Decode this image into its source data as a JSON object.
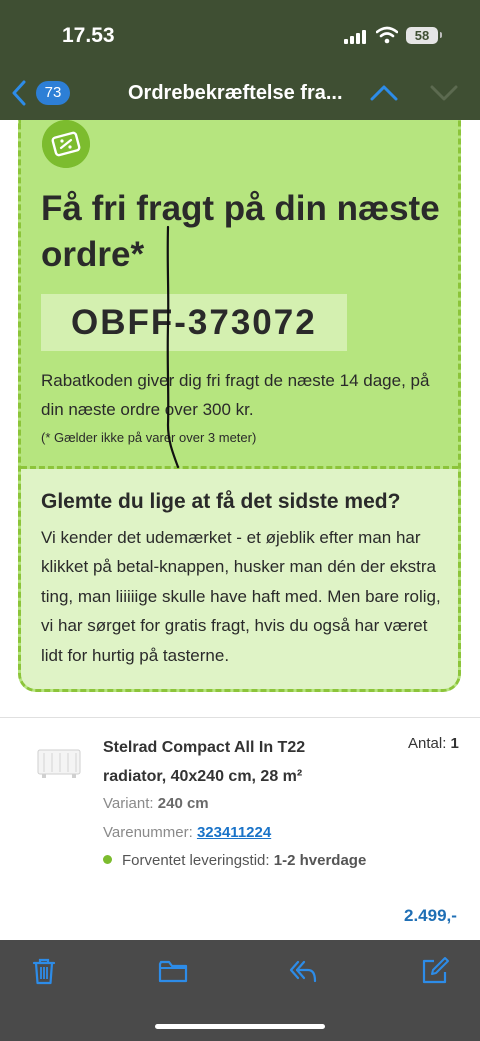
{
  "status_bar": {
    "time": "17.53",
    "battery": "58"
  },
  "nav": {
    "unread_count": "73",
    "title": "Ordrebekræftelse fra..."
  },
  "coupon": {
    "icon": "ticket-icon",
    "headline": "Få fri fragt på din næste ordre*",
    "code": "OBFF-373072",
    "info": "Rabatkoden giver dig fri fragt de næste 14 dage, på din næste ordre over 300 kr.",
    "note": "(* Gælder ikke på varer over 3 meter)",
    "sub_title": "Glemte du lige at få det sidste med?",
    "sub_text": "Vi kender det udemærket - et øjeblik efter man har klikket på betal-knappen, husker man dén der ekstra ting, man liiiiige skulle have haft med. Men bare rolig, vi har sørget for gratis fragt, hvis du også har været lidt for hurtig på tasterne."
  },
  "product": {
    "name": "Stelrad Compact All In T22 radiator, 40x240 cm, 28 m²",
    "qty_label": "Antal:",
    "qty_value": "1",
    "variant_label": "Variant:",
    "variant_value": "240 cm",
    "sku_label": "Varenummer:",
    "sku_value": "323411224",
    "delivery_label": "Forventet leveringstid:",
    "delivery_value": "1-2 hverdage",
    "price": "2.499,-"
  },
  "toolbar": {
    "icons": [
      "trash-icon",
      "folder-icon",
      "reply-icon",
      "compose-icon"
    ]
  },
  "colors": {
    "accent_green": "#b6e57f",
    "link_blue": "#1a73c8",
    "nav_bar": "#3f4f33"
  }
}
